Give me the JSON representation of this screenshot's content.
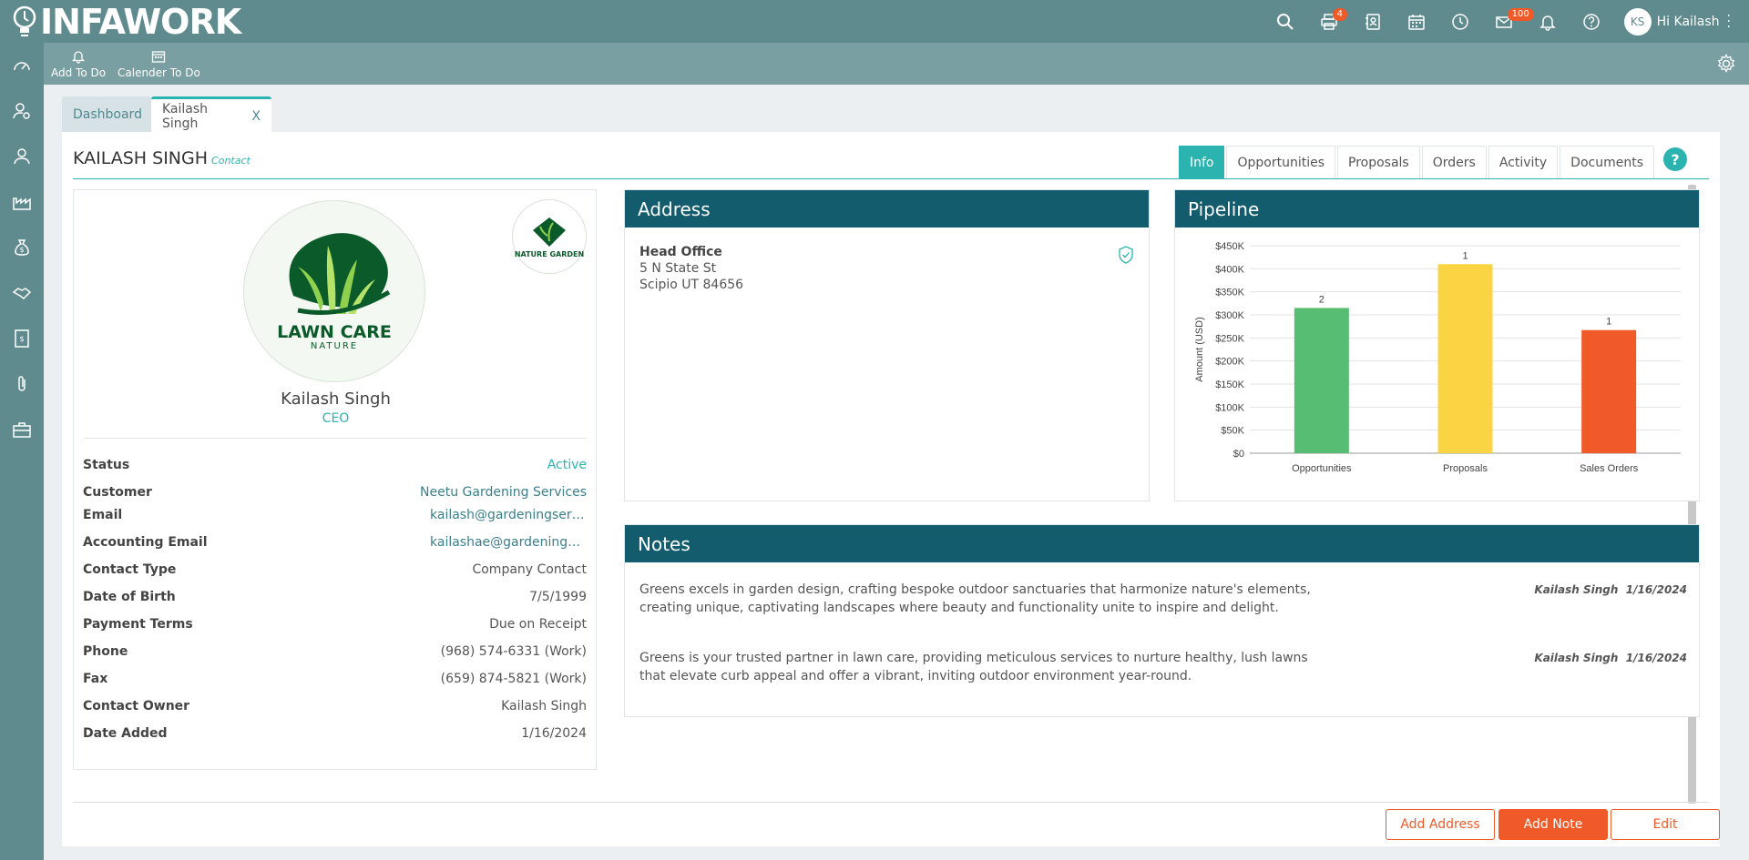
{
  "app": {
    "logo_text": "INFAWORK"
  },
  "topbar": {
    "icons": [
      {
        "name": "search-icon",
        "badge": ""
      },
      {
        "name": "printer-icon",
        "badge": "4"
      },
      {
        "name": "contacts-book-icon",
        "badge": ""
      },
      {
        "name": "calendar-icon",
        "badge": ""
      },
      {
        "name": "clock-icon",
        "badge": ""
      },
      {
        "name": "mail-icon",
        "badge": "100"
      },
      {
        "name": "bell-icon",
        "badge": ""
      },
      {
        "name": "help-icon",
        "badge": ""
      }
    ],
    "user_initials": "KS",
    "user_greeting": "Hi Kailash"
  },
  "toolbar": {
    "add_todo": "Add To Do",
    "calendar_todo": "Calender To Do"
  },
  "page_tabs": {
    "dashboard": "Dashboard",
    "active": "Kailash Singh",
    "close": "X"
  },
  "header": {
    "title": "KAILASH SINGH",
    "subtitle": "Contact"
  },
  "tabs": [
    "Info",
    "Opportunities",
    "Proposals",
    "Orders",
    "Activity",
    "Documents"
  ],
  "help_label": "?",
  "profile": {
    "logo_line1": "LAWN CARE",
    "logo_line2": "NATURE",
    "badge_logo_text": "NATURE GARDEN",
    "name": "Kailash Singh",
    "role": "CEO",
    "fields": [
      {
        "label": "Status",
        "value": "Active"
      },
      {
        "label": "Customer",
        "value": "Neetu Gardening Services"
      },
      {
        "label": "Email",
        "value": "kailash@gardeningservi..."
      },
      {
        "label": "Accounting Email",
        "value": "kailashae@gardeningse..."
      },
      {
        "label": "Contact Type",
        "value": "Company Contact"
      },
      {
        "label": "Date of Birth",
        "value": "7/5/1999"
      },
      {
        "label": "Payment Terms",
        "value": "Due on Receipt"
      },
      {
        "label": "Phone",
        "value": "(968) 574-6331 (Work)"
      },
      {
        "label": "Fax",
        "value": "(659) 874-5821 (Work)"
      },
      {
        "label": "Contact Owner",
        "value": "Kailash Singh"
      },
      {
        "label": "Date Added",
        "value": "1/16/2024"
      }
    ]
  },
  "address": {
    "title": "Address",
    "heading": "Head Office",
    "line1": "5 N State St",
    "line2": "Scipio UT 84656"
  },
  "pipeline": {
    "title": "Pipeline"
  },
  "chart_data": {
    "type": "bar",
    "categories": [
      "Opportunities",
      "Proposals",
      "Sales Orders"
    ],
    "values": [
      315000,
      410000,
      267000
    ],
    "counts": [
      "2",
      "1",
      "1"
    ],
    "colors": [
      "#57bd72",
      "#fbd444",
      "#f05a28"
    ],
    "ylabel": "Amount (USD)",
    "ylim": [
      0,
      450000
    ],
    "yticks": [
      "$0",
      "$50K",
      "$100K",
      "$150K",
      "$200K",
      "$250K",
      "$300K",
      "$350K",
      "$400K",
      "$450K"
    ],
    "grid": true
  },
  "notes": {
    "title": "Notes",
    "items": [
      {
        "text": "Greens excels in garden design, crafting bespoke outdoor sanctuaries that harmonize nature's elements, creating unique, captivating landscapes where beauty and functionality unite to inspire and delight.",
        "author": "Kailash Singh",
        "date": "1/16/2024"
      },
      {
        "text": "Greens is your trusted partner in lawn care, providing meticulous services to nurture healthy, lush lawns that elevate curb appeal and offer a vibrant, inviting outdoor environment year-round.",
        "author": "Kailash Singh",
        "date": "1/16/2024"
      }
    ]
  },
  "actions": {
    "add_address": "Add Address",
    "add_note": "Add Note",
    "edit": "Edit"
  }
}
